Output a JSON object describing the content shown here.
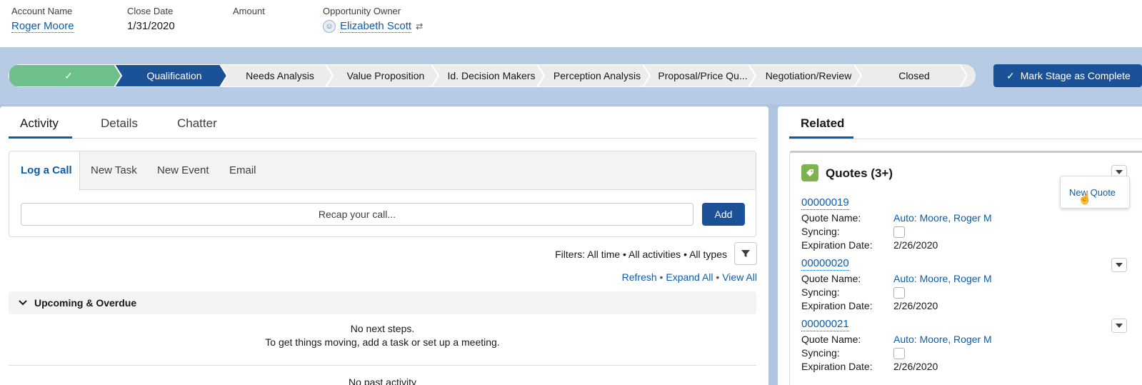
{
  "header": {
    "account_label": "Account Name",
    "account_value": "Roger Moore",
    "close_label": "Close Date",
    "close_value": "1/31/2020",
    "amount_label": "Amount",
    "owner_label": "Opportunity Owner",
    "owner_value": "Elizabeth Scott"
  },
  "path": {
    "stages": [
      "✓",
      "Qualification",
      "Needs Analysis",
      "Value Proposition",
      "Id. Decision Makers",
      "Perception Analysis",
      "Proposal/Price Qu...",
      "Negotiation/Review",
      "Closed"
    ],
    "mark_complete": "Mark Stage as Complete",
    "colors": {
      "done": "#6dc08a",
      "current": "#1b5297",
      "pending": "#ececec"
    }
  },
  "tabs": [
    "Activity",
    "Details",
    "Chatter"
  ],
  "composer": {
    "tabs": [
      "Log a Call",
      "New Task",
      "New Event",
      "Email"
    ],
    "placeholder": "Recap your call...",
    "add": "Add"
  },
  "filters": "Filters: All time • All activities • All types",
  "links": {
    "refresh": "Refresh",
    "expand": "Expand All",
    "view": "View All",
    "sep": " • "
  },
  "upcoming": {
    "title": "Upcoming & Overdue",
    "line1": "No next steps.",
    "line2": "To get things moving, add a task or set up a meeting."
  },
  "past": "No past activity",
  "related": {
    "tab": "Related",
    "quotes_title": "Quotes (3+)",
    "menu_item": "New Quote",
    "labels": {
      "name": "Quote Name:",
      "syncing": "Syncing:",
      "expiration": "Expiration Date:"
    },
    "records": [
      {
        "number": "00000019",
        "name": "Auto: Moore, Roger M",
        "expiration": "2/26/2020"
      },
      {
        "number": "00000020",
        "name": "Auto: Moore, Roger M",
        "expiration": "2/26/2020"
      },
      {
        "number": "00000021",
        "name": "Auto: Moore, Roger M",
        "expiration": "2/26/2020"
      }
    ]
  }
}
